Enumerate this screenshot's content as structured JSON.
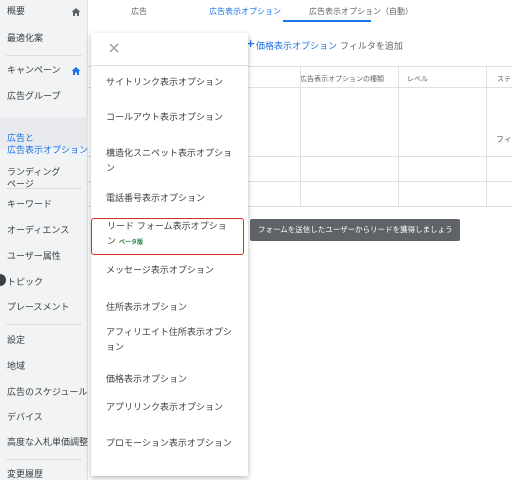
{
  "sidebar": {
    "items": [
      {
        "label": "概要",
        "home": true
      },
      {
        "label": "最適化案",
        "home": false
      },
      {
        "label": "キャンペーン",
        "home": true
      },
      {
        "label": "広告グループ",
        "home": false
      },
      {
        "label": "広告と\n広告表示オプション",
        "home": false,
        "selected": true
      },
      {
        "label": "ランディング\nページ",
        "home": false
      },
      {
        "label": "キーワード",
        "home": false
      },
      {
        "label": "オーディエンス",
        "home": false
      },
      {
        "label": "ユーザー属性",
        "home": false
      },
      {
        "label": "トピック",
        "home": false
      },
      {
        "label": "プレースメント",
        "home": false
      },
      {
        "label": "設定",
        "home": false
      },
      {
        "label": "地域",
        "home": false
      },
      {
        "label": "広告のスケジュール",
        "home": false
      },
      {
        "label": "デバイス",
        "home": false
      },
      {
        "label": "高度な入札単価調整",
        "home": false
      },
      {
        "label": "変更履歴",
        "home": false
      }
    ]
  },
  "tabs": [
    {
      "label": "広告",
      "active": false
    },
    {
      "label": "広告表示オプション",
      "active": true
    },
    {
      "label": "広告表示オプション（自動）",
      "active": false
    }
  ],
  "toolbar": {
    "add_label": "+",
    "button_label": "価格表示オプション",
    "filter_label": "フィルタを追加"
  },
  "table": {
    "headers": [
      "広告表示オプションの種類",
      "レベル",
      "ステ"
    ],
    "partial_text": "フィ"
  },
  "menu": {
    "options": [
      "サイトリンク表示オプション",
      "コールアウト表示オプション",
      "構造化スニペット表示オプション",
      "電話番号表示オプション",
      "リード フォーム表示オプション",
      "メッセージ表示オプション",
      "住所表示オプション",
      "アフィリエイト住所表示オプション",
      "価格表示オプション",
      "アプリリンク表示オプション",
      "プロモーション表示オプション"
    ],
    "highlighted_index": 4,
    "beta_badge": "ベータ版"
  },
  "tooltip": {
    "text": "フォームを送信したユーザーからリードを獲得しましょう"
  },
  "colors": {
    "accent": "#1a73e8",
    "highlight_border": "#d93025",
    "beta": "#188038",
    "tooltip_bg": "#5f6368"
  }
}
